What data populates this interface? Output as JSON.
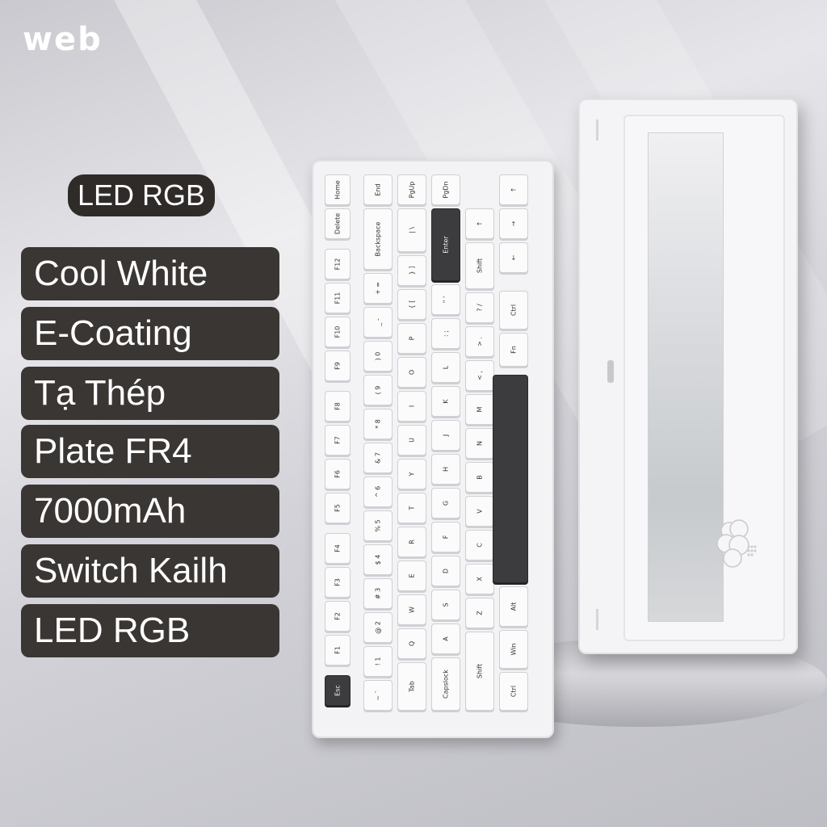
{
  "logo_text": "web",
  "top_badge": "LED RGB",
  "specs": [
    "Cool White",
    "E-Coating",
    "Tạ Thép",
    "Plate FR4",
    "7000mAh",
    "Switch Kailh",
    "LED RGB"
  ],
  "keys": {
    "home": "Home",
    "end": "End",
    "pgup": "PgUp",
    "pgdn": "PgDn",
    "backspace": "Backspace",
    "enter": "Enter",
    "shift": "Shift",
    "ctrl": "Ctrl",
    "fn": "Fn",
    "alt": "Alt",
    "win": "Win",
    "tab": "Tab",
    "capslock": "Capslock",
    "esc": "Esc",
    "delete": "Delete"
  }
}
